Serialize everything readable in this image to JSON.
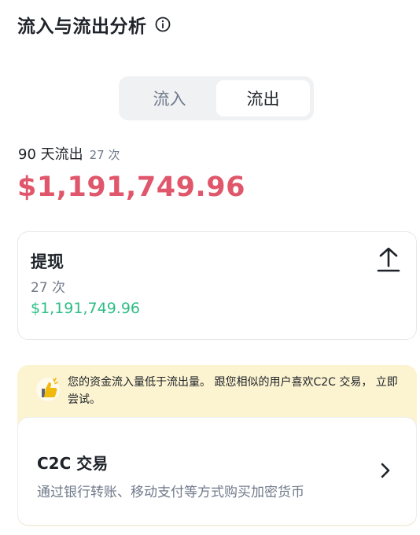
{
  "header": {
    "title": "流入与流出分析",
    "info_icon": "info-icon"
  },
  "toggle": {
    "tabs": [
      "流入",
      "流出"
    ],
    "active": "流出"
  },
  "summary": {
    "period_label": "90 天流出",
    "count": "27 次",
    "total": "$1,191,749.96"
  },
  "withdraw_card": {
    "name": "提现",
    "count": "27 次",
    "amount": "$1,191,749.96",
    "icon": "upload-icon"
  },
  "promo": {
    "icon": "thumbs-up-bulb-icon",
    "text": "您的资金流入量低于流出量。 跟您相似的用户喜欢C2C 交易， 立即尝试。",
    "item": {
      "name": "C2C 交易",
      "description": "通过银行转账、移动支付等方式购买加密货币",
      "icon": "chevron-right-icon"
    }
  },
  "colors": {
    "negative": "#e0566a",
    "positive": "#2ebd85",
    "promo_bg": "#fcf3d0"
  }
}
